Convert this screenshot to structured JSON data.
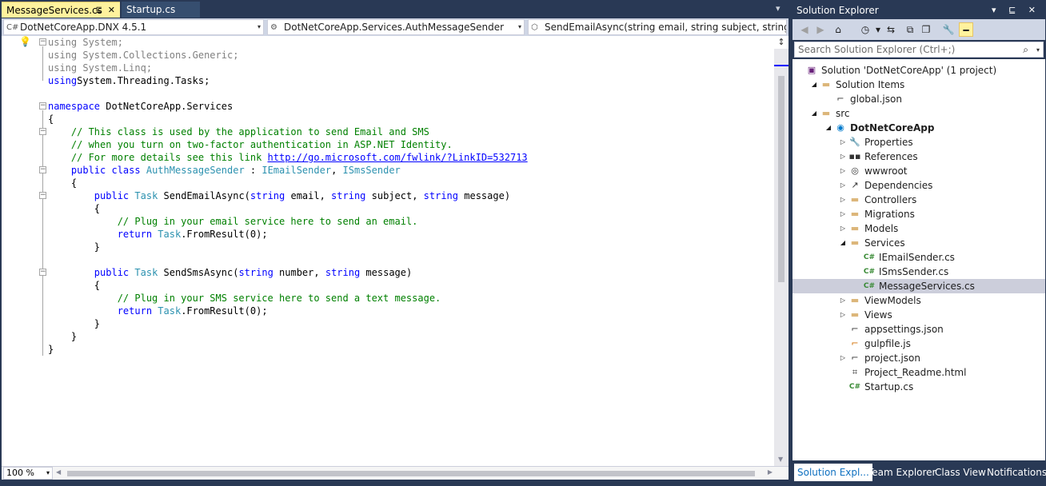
{
  "editor": {
    "tabs": [
      {
        "label": "MessageServices.cs",
        "active": true,
        "pin_glyph": "⊑",
        "close_glyph": "✕"
      },
      {
        "label": "Startup.cs",
        "active": false
      }
    ],
    "tab_dropdown_glyph": "▾",
    "nav": {
      "project": "DotNetCoreApp.DNX 4.5.1",
      "project_icon": "C#",
      "type": "DotNetCoreApp.Services.AuthMessageSender",
      "type_icon": "⚙",
      "member": "SendEmailAsync(string email, string subject, string message)",
      "member_icon": "⬡",
      "arrow": "▾"
    },
    "lightbulb_icon": "💡",
    "split_glyph": "↕",
    "zoom": "100 %",
    "colors": {
      "keyword": "#0000FF",
      "comment": "#008000",
      "type": "#2B91AF",
      "active_tab": "#FFF29D"
    }
  },
  "code": [
    [
      [
        "gr",
        "using"
      ],
      [
        "gr",
        " System;"
      ]
    ],
    [
      [
        "gr",
        "using"
      ],
      [
        "gr",
        " System.Collections.Generic;"
      ]
    ],
    [
      [
        "gr",
        "using"
      ],
      [
        "gr",
        " System.Linq;"
      ]
    ],
    [
      [
        "kw",
        "using"
      ],
      [
        "",
        "System.Threading.Tasks;"
      ]
    ],
    [
      [
        "",
        ""
      ]
    ],
    [
      [
        "kw",
        "namespace"
      ],
      [
        "",
        " DotNetCoreApp.Services"
      ]
    ],
    [
      [
        "",
        "{"
      ]
    ],
    [
      [
        "cm",
        "    // This class is used by the application to send Email and SMS"
      ]
    ],
    [
      [
        "cm",
        "    // when you turn on two-factor authentication in ASP.NET Identity."
      ]
    ],
    [
      [
        "cm",
        "    // For more details see this link "
      ],
      [
        "lnk",
        "http://go.microsoft.com/fwlink/?LinkID=532713"
      ]
    ],
    [
      [
        "kw",
        "    public"
      ],
      [
        "",
        " "
      ],
      [
        "kw",
        "class"
      ],
      [
        "",
        " "
      ],
      [
        "ty",
        "AuthMessageSender"
      ],
      [
        "",
        " : "
      ],
      [
        "ty",
        "IEmailSender"
      ],
      [
        "",
        ", "
      ],
      [
        "ty",
        "ISmsSender"
      ]
    ],
    [
      [
        "",
        "    {"
      ]
    ],
    [
      [
        "kw",
        "        public"
      ],
      [
        "",
        " "
      ],
      [
        "ty",
        "Task"
      ],
      [
        "",
        " SendEmailAsync("
      ],
      [
        "kw",
        "string"
      ],
      [
        "",
        " email, "
      ],
      [
        "kw",
        "string"
      ],
      [
        "",
        " subject, "
      ],
      [
        "kw",
        "string"
      ],
      [
        "",
        " message)"
      ]
    ],
    [
      [
        "",
        "        {"
      ]
    ],
    [
      [
        "cm",
        "            // Plug in your email service here to send an email."
      ]
    ],
    [
      [
        "kw",
        "            return"
      ],
      [
        "",
        " "
      ],
      [
        "ty",
        "Task"
      ],
      [
        "",
        ".FromResult(0);"
      ]
    ],
    [
      [
        "",
        "        }"
      ]
    ],
    [
      [
        "",
        ""
      ]
    ],
    [
      [
        "kw",
        "        public"
      ],
      [
        "",
        " "
      ],
      [
        "ty",
        "Task"
      ],
      [
        "",
        " SendSmsAsync("
      ],
      [
        "kw",
        "string"
      ],
      [
        "",
        " number, "
      ],
      [
        "kw",
        "string"
      ],
      [
        "",
        " message)"
      ]
    ],
    [
      [
        "",
        "        {"
      ]
    ],
    [
      [
        "cm",
        "            // Plug in your SMS service here to send a text message."
      ]
    ],
    [
      [
        "kw",
        "            return"
      ],
      [
        "",
        " "
      ],
      [
        "ty",
        "Task"
      ],
      [
        "",
        ".FromResult(0);"
      ]
    ],
    [
      [
        "",
        "        }"
      ]
    ],
    [
      [
        "",
        "    }"
      ]
    ],
    [
      [
        "",
        "}"
      ]
    ]
  ],
  "solution_explorer": {
    "title": "Solution Explorer",
    "title_buttons": "▾ ⊑ ✕",
    "toolbar": [
      {
        "name": "back-icon",
        "glyph": "◀",
        "dim": true
      },
      {
        "name": "forward-icon",
        "glyph": "▶",
        "dim": true
      },
      {
        "name": "home-icon",
        "glyph": "⌂"
      },
      {
        "name": "history-icon",
        "glyph": "◷"
      },
      {
        "name": "history-dropdown-icon",
        "glyph": "▾"
      },
      {
        "name": "sync-icon",
        "glyph": "⇆"
      },
      {
        "name": "collapse-all-icon",
        "glyph": "⧉"
      },
      {
        "name": "show-all-files-icon",
        "glyph": "❐"
      },
      {
        "name": "properties-wrench-icon",
        "glyph": "🔧"
      },
      {
        "name": "preview-icon",
        "glyph": "━",
        "pressed": true
      }
    ],
    "search_placeholder": "Search Solution Explorer (Ctrl+;)",
    "search_icon": "⌕",
    "search_arrow": "▾",
    "tree": [
      {
        "label": "Solution 'DotNetCoreApp' (1 project)",
        "level": 0,
        "icon": "▣",
        "icon_class": "ic-sln",
        "icon_name": "solution-icon"
      },
      {
        "label": "Solution Items",
        "level": 1,
        "icon": "▬",
        "icon_class": "ic-folder",
        "expander": "◢",
        "icon_name": "folder-icon"
      },
      {
        "label": "global.json",
        "level": 2,
        "icon": "⌐",
        "icon_class": "ic-json",
        "icon_name": "json-file-icon"
      },
      {
        "label": "src",
        "level": 1,
        "icon": "▬",
        "icon_class": "ic-folder",
        "expander": "◢",
        "icon_name": "folder-icon"
      },
      {
        "label": "DotNetCoreApp",
        "level": 2,
        "icon": "◉",
        "icon_class": "ic-proj",
        "expander": "◢",
        "bold": true,
        "icon_name": "web-project-icon"
      },
      {
        "label": "Properties",
        "level": 3,
        "icon": "🔧",
        "icon_class": "ic-dark",
        "expander": "▷",
        "icon_name": "wrench-icon"
      },
      {
        "label": "References",
        "level": 3,
        "icon": "▪▪",
        "icon_class": "ic-dark",
        "expander": "▷",
        "icon_name": "references-icon"
      },
      {
        "label": "wwwroot",
        "level": 3,
        "icon": "◎",
        "icon_class": "ic-dark",
        "expander": "▷",
        "icon_name": "globe-icon"
      },
      {
        "label": "Dependencies",
        "level": 3,
        "icon": "↗",
        "icon_class": "ic-dark",
        "expander": "▷",
        "icon_name": "dependencies-icon"
      },
      {
        "label": "Controllers",
        "level": 3,
        "icon": "▬",
        "icon_class": "ic-folder",
        "expander": "▷",
        "icon_name": "folder-icon"
      },
      {
        "label": "Migrations",
        "level": 3,
        "icon": "▬",
        "icon_class": "ic-folder",
        "expander": "▷",
        "icon_name": "folder-icon"
      },
      {
        "label": "Models",
        "level": 3,
        "icon": "▬",
        "icon_class": "ic-folder",
        "expander": "▷",
        "icon_name": "folder-icon"
      },
      {
        "label": "Services",
        "level": 3,
        "icon": "▬",
        "icon_class": "ic-folder",
        "expander": "◢",
        "icon_name": "folder-icon"
      },
      {
        "label": "IEmailSender.cs",
        "level": 4,
        "icon": "C#",
        "icon_class": "ic-cs",
        "icon_name": "csharp-file-icon"
      },
      {
        "label": "ISmsSender.cs",
        "level": 4,
        "icon": "C#",
        "icon_class": "ic-cs",
        "icon_name": "csharp-file-icon"
      },
      {
        "label": "MessageServices.cs",
        "level": 4,
        "icon": "C#",
        "icon_class": "ic-cs",
        "selected": true,
        "icon_name": "csharp-file-icon"
      },
      {
        "label": "ViewModels",
        "level": 3,
        "icon": "▬",
        "icon_class": "ic-folder",
        "expander": "▷",
        "icon_name": "folder-icon"
      },
      {
        "label": "Views",
        "level": 3,
        "icon": "▬",
        "icon_class": "ic-folder",
        "expander": "▷",
        "icon_name": "folder-icon"
      },
      {
        "label": "appsettings.json",
        "level": 3,
        "icon": "⌐",
        "icon_class": "ic-json",
        "icon_name": "json-file-icon"
      },
      {
        "label": "gulpfile.js",
        "level": 3,
        "icon": "⌐",
        "icon_class": "ic-js",
        "icon_name": "js-file-icon"
      },
      {
        "label": "project.json",
        "level": 3,
        "icon": "⌐",
        "icon_class": "ic-json",
        "expander": "▷",
        "icon_name": "json-file-icon"
      },
      {
        "label": "Project_Readme.html",
        "level": 3,
        "icon": "⌗",
        "icon_class": "ic-json",
        "icon_name": "html-file-icon"
      },
      {
        "label": "Startup.cs",
        "level": 3,
        "icon": "C#",
        "icon_class": "ic-cs",
        "icon_name": "csharp-file-icon"
      }
    ],
    "bottom_tabs": [
      {
        "label": "Solution Expl...",
        "active": true
      },
      {
        "label": "Team Explorer"
      },
      {
        "label": "Class View"
      },
      {
        "label": "Notifications"
      }
    ]
  }
}
